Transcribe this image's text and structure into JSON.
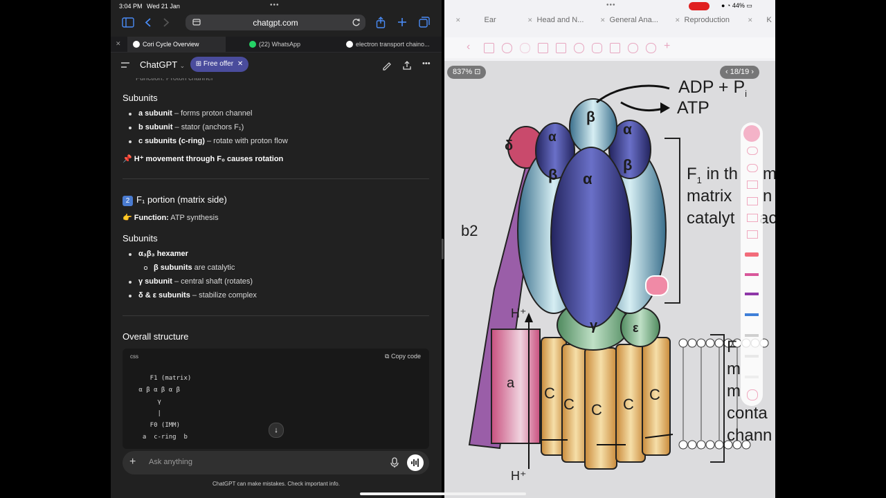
{
  "status": {
    "time": "3:04 PM",
    "date": "Wed 21 Jan",
    "battery": "44%"
  },
  "browser": {
    "url": "chatgpt.com",
    "tabs": [
      {
        "label": "Cori Cycle Overview"
      },
      {
        "label": "(22) WhatsApp"
      },
      {
        "label": "electron transport chaino..."
      }
    ]
  },
  "chat": {
    "header": {
      "title": "ChatGPT",
      "offer": "Free offer"
    },
    "partial_line": "Function: Proton channel",
    "f0_section": {
      "subunits_title": "Subunits",
      "items": [
        {
          "bold": "a subunit",
          "text": " – forms proton channel"
        },
        {
          "bold": "b subunit",
          "text": " – stator (anchors F₁)"
        },
        {
          "bold": "c subunits (c-ring)",
          "text": " – rotate with proton flow"
        }
      ],
      "note": "📌 H⁺ movement through F₀ causes rotation"
    },
    "f1_section": {
      "number": "2",
      "title": "F₁ portion (matrix side)",
      "function_label": "👉 Function:",
      "function_value": " ATP synthesis",
      "subunits_title": "Subunits",
      "items": [
        {
          "bold": "α₃β₃ hexamer",
          "text": ""
        },
        {
          "bold": "β subunits",
          "text": " are catalytic"
        },
        {
          "bold": "γ subunit",
          "text": " – central shaft (rotates)"
        },
        {
          "bold": "δ & ε subunits",
          "text": " – stabilize complex"
        }
      ]
    },
    "overall": {
      "title": "Overall structure",
      "code_lang": "css",
      "copy_label": "Copy code",
      "code_lines": [
        "    F1 (matrix)",
        " α β α β α β",
        "      γ",
        "      |",
        "    F0 (IMM)",
        "  a  c-ring  b"
      ]
    },
    "input_placeholder": "Ask anything",
    "disclaimer": "ChatGPT can make mistakes. Check important info."
  },
  "notes_app": {
    "tabs": [
      {
        "label": "Ear"
      },
      {
        "label": "Head and N..."
      },
      {
        "label": "General Ana..."
      },
      {
        "label": "Reproduction"
      },
      {
        "label": "K"
      }
    ],
    "zoom": "837%",
    "pages": "18/19",
    "figure_labels": {
      "adp": "ADP + P",
      "adp_sub": "i",
      "atp": "ATP",
      "beta": "β",
      "alpha": "α",
      "delta": "δ",
      "gamma": "γ",
      "epsilon": "ε",
      "b2": "b2",
      "a": "a",
      "c": "C",
      "hplus": "H⁺",
      "f1_line1": "F",
      "f1_sub": "1",
      "f1_rest": " in th",
      "f1_line2": "matrix",
      "f1_line3": "catalyt",
      "f1_r1": "m",
      "f1_r2": "n",
      "f1_r3": "ac",
      "f0_line1": "F",
      "f0_line2": "m",
      "f0_line3": "m",
      "f0_line4": "conta",
      "f0_line5": "chann"
    }
  }
}
